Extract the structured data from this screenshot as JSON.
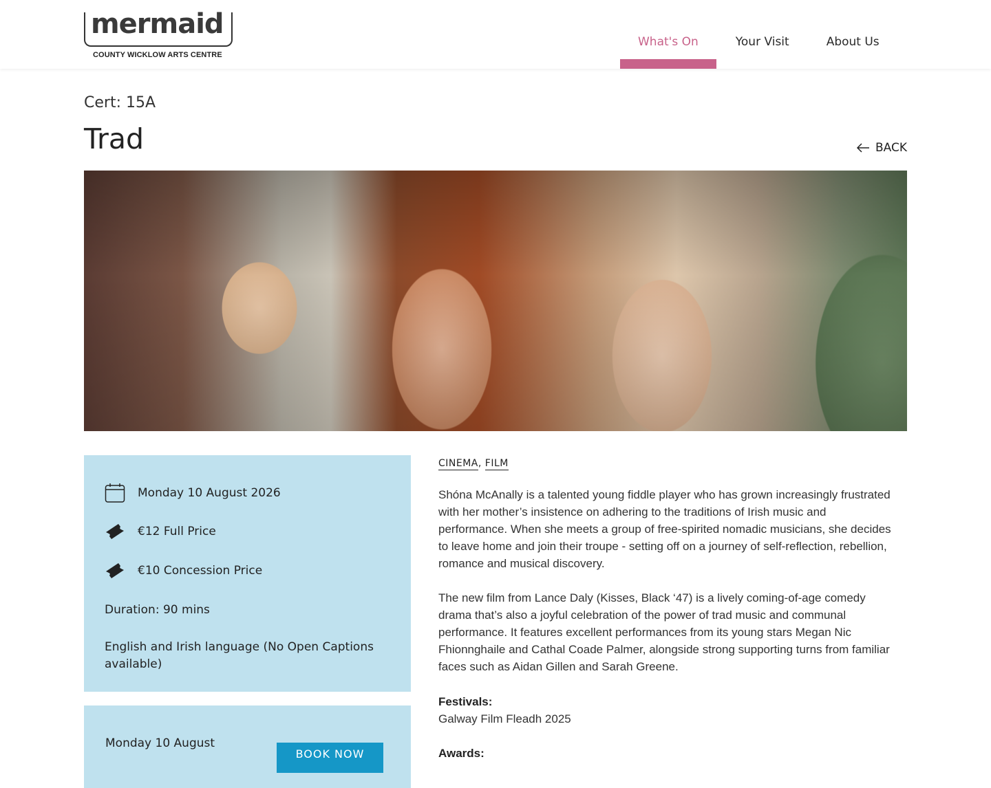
{
  "header": {
    "logo_word": "mermaid",
    "logo_sub": "COUNTY WICKLOW ARTS CENTRE",
    "nav": [
      "What's On",
      "Your Visit",
      "About Us"
    ],
    "accent_color": "#c8628a"
  },
  "event": {
    "cert": "Cert: 15A",
    "title": "Trad",
    "back_label": "BACK"
  },
  "info": {
    "date": "Monday 10 August 2026",
    "price_full": "€12 Full Price",
    "price_concession": "€10 Concession Price",
    "duration": "Duration: 90 mins",
    "language": "English and Irish language (No Open Captions available)",
    "panel_color": "#bfe1ee"
  },
  "booking": {
    "date": "Monday 10 August",
    "button_label": "BOOK NOW",
    "button_color": "#1597c7"
  },
  "tags": [
    "CINEMA",
    "FILM"
  ],
  "description": {
    "para1": "Shóna McAnally is a talented young fiddle player who has grown increasingly frustrated with her mother’s insistence on adhering to the traditions of Irish music and performance. When she meets a group of free-spirited nomadic musicians, she decides to leave home and join their troupe - setting off on a journey of self-reflection, rebellion, romance and musical discovery.",
    "para2": "The new film from Lance Daly (Kisses, Black ‘47) is a lively coming-of-age comedy drama that’s also a joyful celebration of the power of trad music and communal performance. It features excellent performances from its young stars Megan Nic Fhionnghaile and Cathal Coade Palmer, alongside strong supporting turns from familiar faces such as Aidan Gillen and Sarah Greene.",
    "festivals_label": "Festivals:",
    "festivals_value": "Galway Film Fleadh 2025",
    "awards_label": "Awards:"
  }
}
